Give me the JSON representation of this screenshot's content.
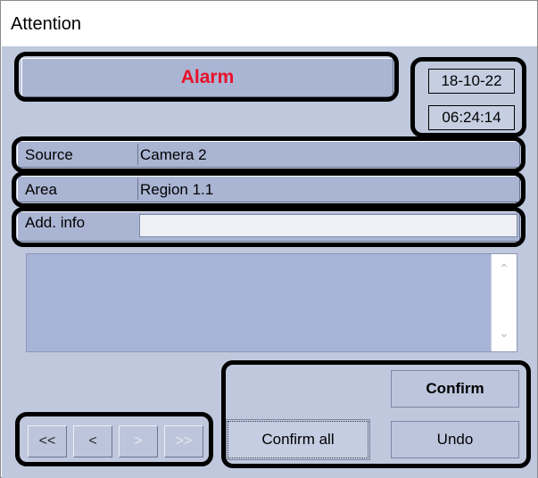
{
  "window": {
    "title": "Attention"
  },
  "event": {
    "type_label": "Alarm",
    "date": "18-10-22",
    "time": "06:24:14",
    "accent_color": "#e8102a"
  },
  "fields": [
    {
      "label": "Source",
      "value": "Camera 2"
    },
    {
      "label": "Area",
      "value": "Region 1.1"
    },
    {
      "label": "Add. info",
      "value": ""
    }
  ],
  "memo": {
    "text": "",
    "scroll_up_icon": "chevron-up-icon",
    "scroll_down_icon": "chevron-down-icon"
  },
  "navigation": {
    "first": "<<",
    "prev": "<",
    "next": ">",
    "last": ">>"
  },
  "actions": {
    "confirm": "Confirm",
    "confirm_all": "Confirm all",
    "undo": "Undo"
  }
}
